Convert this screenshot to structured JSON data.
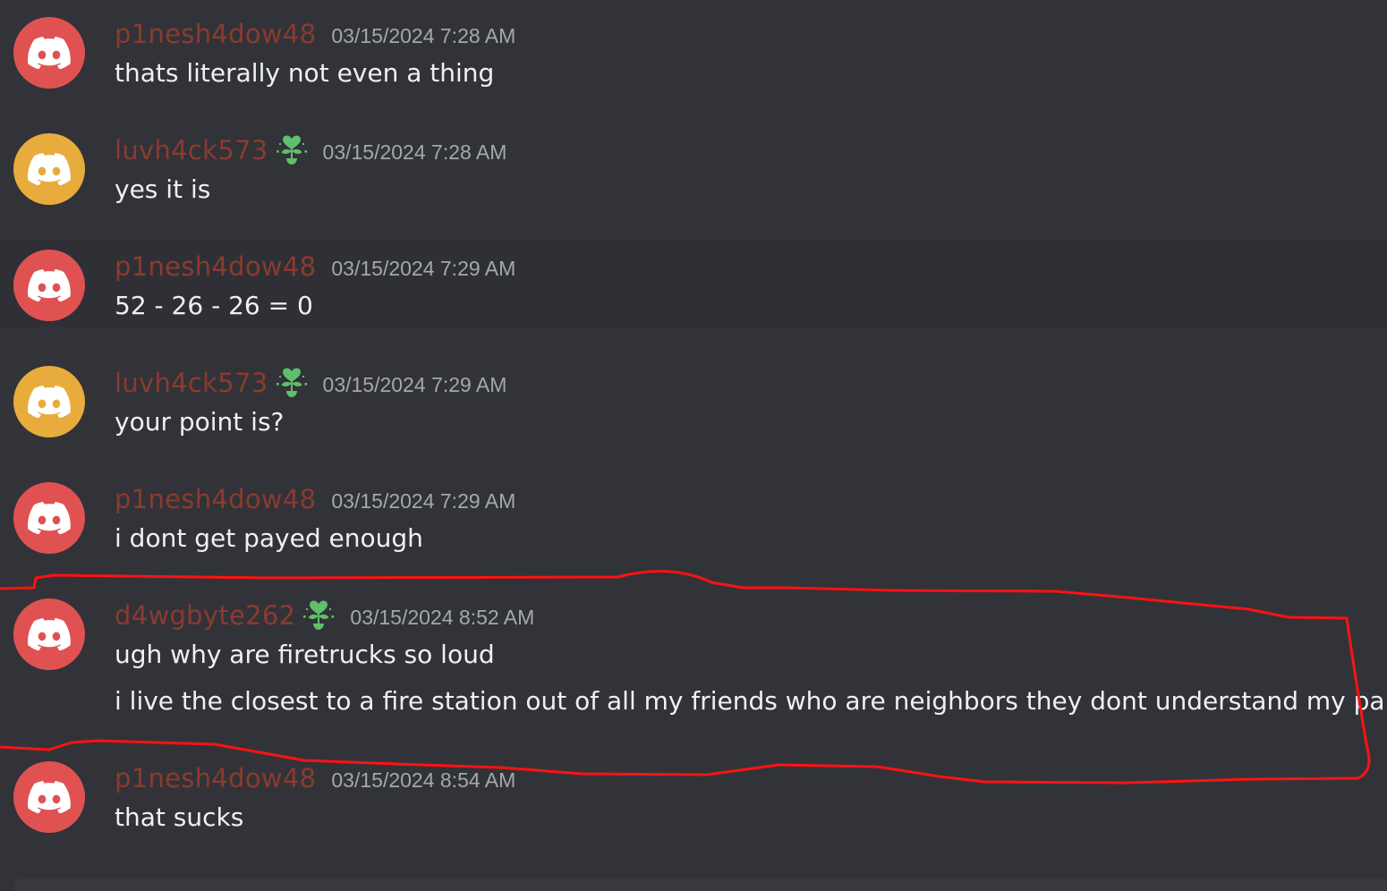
{
  "colors": {
    "background": "#313338",
    "hover_row": "#2e3035",
    "username": "#8c3a2f",
    "timestamp": "#a4a7ad",
    "text": "#eef0f2",
    "avatar_red": "#e05252",
    "avatar_yellow": "#e8ac3c",
    "badge_green": "#5fbf6a",
    "annotation_red": "#ff0000"
  },
  "messages": [
    {
      "username": "p1nesh4dow48",
      "timestamp": "03/15/2024 7:28 AM",
      "avatar": "discord-logo-icon",
      "avatar_color": "red",
      "badge": null,
      "lines": [
        "thats literally not even a thing"
      ]
    },
    {
      "username": "luvh4ck573",
      "timestamp": "03/15/2024 7:28 AM",
      "avatar": "discord-logo-icon",
      "avatar_color": "yellow",
      "badge": "leaf-heart-icon",
      "lines": [
        "yes it is"
      ]
    },
    {
      "username": "p1nesh4dow48",
      "timestamp": "03/15/2024 7:29 AM",
      "avatar": "discord-logo-icon",
      "avatar_color": "red",
      "badge": null,
      "lines": [
        "52 - 26 - 26 = 0"
      ]
    },
    {
      "username": "luvh4ck573",
      "timestamp": "03/15/2024 7:29 AM",
      "avatar": "discord-logo-icon",
      "avatar_color": "yellow",
      "badge": "leaf-heart-icon",
      "lines": [
        "your point is?"
      ]
    },
    {
      "username": "p1nesh4dow48",
      "timestamp": "03/15/2024 7:29 AM",
      "avatar": "discord-logo-icon",
      "avatar_color": "red",
      "badge": null,
      "lines": [
        "i dont get payed enough"
      ]
    },
    {
      "username": "d4wgbyte262",
      "timestamp": "03/15/2024 8:52 AM",
      "avatar": "discord-logo-icon",
      "avatar_color": "red",
      "badge": "leaf-heart-icon",
      "lines": [
        "ugh why are firetrucks so loud",
        "i live the closest to a fire station out of all my friends who are neighbors they dont understand my pain"
      ]
    },
    {
      "username": "p1nesh4dow48",
      "timestamp": "03/15/2024 8:54 AM",
      "avatar": "discord-logo-icon",
      "avatar_color": "red",
      "badge": null,
      "lines": [
        "that sucks"
      ]
    }
  ]
}
